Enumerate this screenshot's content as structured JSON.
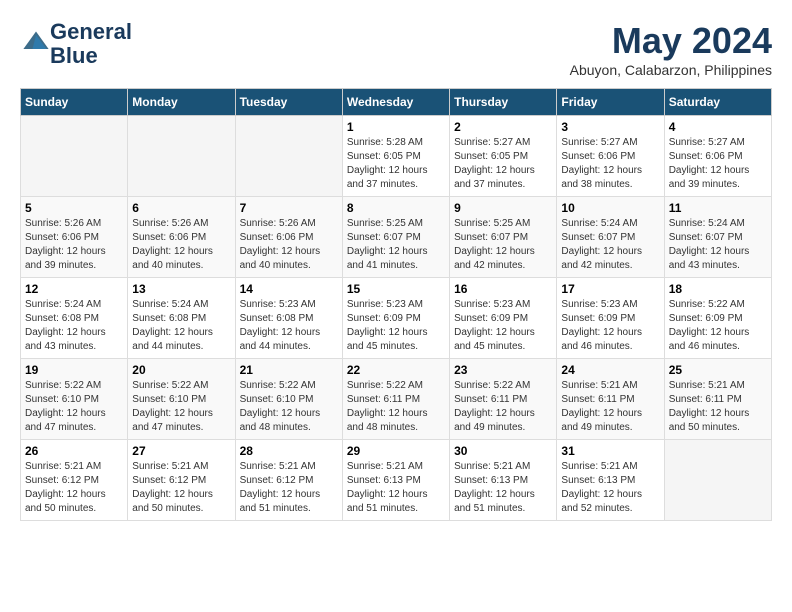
{
  "header": {
    "logo_line1": "General",
    "logo_line2": "Blue",
    "month_title": "May 2024",
    "location": "Abuyon, Calabarzon, Philippines"
  },
  "calendar": {
    "days_of_week": [
      "Sunday",
      "Monday",
      "Tuesday",
      "Wednesday",
      "Thursday",
      "Friday",
      "Saturday"
    ],
    "weeks": [
      [
        {
          "day": "",
          "info": ""
        },
        {
          "day": "",
          "info": ""
        },
        {
          "day": "",
          "info": ""
        },
        {
          "day": "1",
          "info": "Sunrise: 5:28 AM\nSunset: 6:05 PM\nDaylight: 12 hours\nand 37 minutes."
        },
        {
          "day": "2",
          "info": "Sunrise: 5:27 AM\nSunset: 6:05 PM\nDaylight: 12 hours\nand 37 minutes."
        },
        {
          "day": "3",
          "info": "Sunrise: 5:27 AM\nSunset: 6:06 PM\nDaylight: 12 hours\nand 38 minutes."
        },
        {
          "day": "4",
          "info": "Sunrise: 5:27 AM\nSunset: 6:06 PM\nDaylight: 12 hours\nand 39 minutes."
        }
      ],
      [
        {
          "day": "5",
          "info": "Sunrise: 5:26 AM\nSunset: 6:06 PM\nDaylight: 12 hours\nand 39 minutes."
        },
        {
          "day": "6",
          "info": "Sunrise: 5:26 AM\nSunset: 6:06 PM\nDaylight: 12 hours\nand 40 minutes."
        },
        {
          "day": "7",
          "info": "Sunrise: 5:26 AM\nSunset: 6:06 PM\nDaylight: 12 hours\nand 40 minutes."
        },
        {
          "day": "8",
          "info": "Sunrise: 5:25 AM\nSunset: 6:07 PM\nDaylight: 12 hours\nand 41 minutes."
        },
        {
          "day": "9",
          "info": "Sunrise: 5:25 AM\nSunset: 6:07 PM\nDaylight: 12 hours\nand 42 minutes."
        },
        {
          "day": "10",
          "info": "Sunrise: 5:24 AM\nSunset: 6:07 PM\nDaylight: 12 hours\nand 42 minutes."
        },
        {
          "day": "11",
          "info": "Sunrise: 5:24 AM\nSunset: 6:07 PM\nDaylight: 12 hours\nand 43 minutes."
        }
      ],
      [
        {
          "day": "12",
          "info": "Sunrise: 5:24 AM\nSunset: 6:08 PM\nDaylight: 12 hours\nand 43 minutes."
        },
        {
          "day": "13",
          "info": "Sunrise: 5:24 AM\nSunset: 6:08 PM\nDaylight: 12 hours\nand 44 minutes."
        },
        {
          "day": "14",
          "info": "Sunrise: 5:23 AM\nSunset: 6:08 PM\nDaylight: 12 hours\nand 44 minutes."
        },
        {
          "day": "15",
          "info": "Sunrise: 5:23 AM\nSunset: 6:09 PM\nDaylight: 12 hours\nand 45 minutes."
        },
        {
          "day": "16",
          "info": "Sunrise: 5:23 AM\nSunset: 6:09 PM\nDaylight: 12 hours\nand 45 minutes."
        },
        {
          "day": "17",
          "info": "Sunrise: 5:23 AM\nSunset: 6:09 PM\nDaylight: 12 hours\nand 46 minutes."
        },
        {
          "day": "18",
          "info": "Sunrise: 5:22 AM\nSunset: 6:09 PM\nDaylight: 12 hours\nand 46 minutes."
        }
      ],
      [
        {
          "day": "19",
          "info": "Sunrise: 5:22 AM\nSunset: 6:10 PM\nDaylight: 12 hours\nand 47 minutes."
        },
        {
          "day": "20",
          "info": "Sunrise: 5:22 AM\nSunset: 6:10 PM\nDaylight: 12 hours\nand 47 minutes."
        },
        {
          "day": "21",
          "info": "Sunrise: 5:22 AM\nSunset: 6:10 PM\nDaylight: 12 hours\nand 48 minutes."
        },
        {
          "day": "22",
          "info": "Sunrise: 5:22 AM\nSunset: 6:11 PM\nDaylight: 12 hours\nand 48 minutes."
        },
        {
          "day": "23",
          "info": "Sunrise: 5:22 AM\nSunset: 6:11 PM\nDaylight: 12 hours\nand 49 minutes."
        },
        {
          "day": "24",
          "info": "Sunrise: 5:21 AM\nSunset: 6:11 PM\nDaylight: 12 hours\nand 49 minutes."
        },
        {
          "day": "25",
          "info": "Sunrise: 5:21 AM\nSunset: 6:11 PM\nDaylight: 12 hours\nand 50 minutes."
        }
      ],
      [
        {
          "day": "26",
          "info": "Sunrise: 5:21 AM\nSunset: 6:12 PM\nDaylight: 12 hours\nand 50 minutes."
        },
        {
          "day": "27",
          "info": "Sunrise: 5:21 AM\nSunset: 6:12 PM\nDaylight: 12 hours\nand 50 minutes."
        },
        {
          "day": "28",
          "info": "Sunrise: 5:21 AM\nSunset: 6:12 PM\nDaylight: 12 hours\nand 51 minutes."
        },
        {
          "day": "29",
          "info": "Sunrise: 5:21 AM\nSunset: 6:13 PM\nDaylight: 12 hours\nand 51 minutes."
        },
        {
          "day": "30",
          "info": "Sunrise: 5:21 AM\nSunset: 6:13 PM\nDaylight: 12 hours\nand 51 minutes."
        },
        {
          "day": "31",
          "info": "Sunrise: 5:21 AM\nSunset: 6:13 PM\nDaylight: 12 hours\nand 52 minutes."
        },
        {
          "day": "",
          "info": ""
        }
      ]
    ]
  }
}
